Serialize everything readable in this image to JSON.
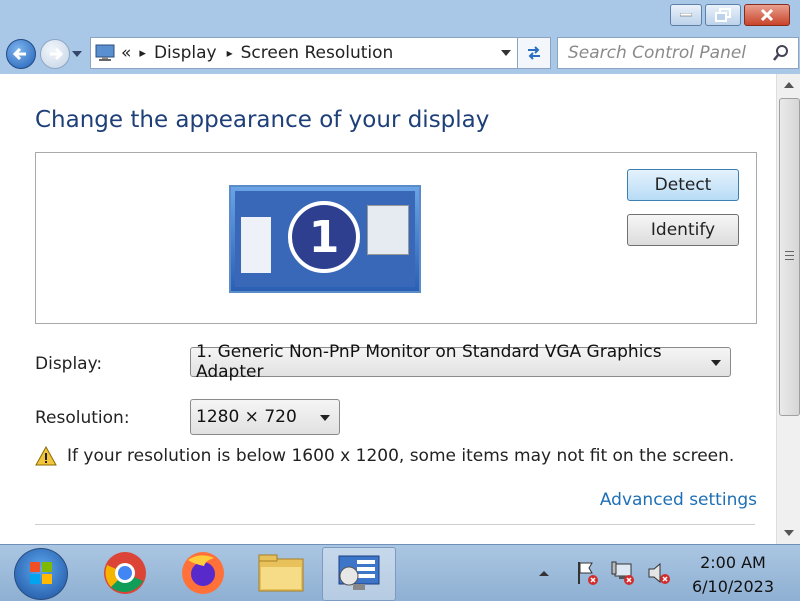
{
  "window": {
    "controls": {
      "minimize_icon": "minimize-icon",
      "maximize_icon": "restore-icon",
      "close_icon": "close-icon"
    }
  },
  "address": {
    "overflow": "«",
    "crumbs": [
      "Display",
      "Screen Resolution"
    ],
    "search_placeholder": "Search Control Panel"
  },
  "main": {
    "title": "Change the appearance of your display",
    "monitor_number": "1",
    "detect_button": "Detect",
    "identify_button": "Identify",
    "display_label": "Display:",
    "display_value": "1. Generic Non-PnP Monitor on Standard VGA Graphics Adapter",
    "resolution_label": "Resolution:",
    "resolution_value": "1280 × 720",
    "warning": "If your resolution is below 1600 x 1200, some items may not fit on the screen.",
    "advanced_link": "Advanced settings"
  },
  "taskbar": {
    "items": [
      "start-button",
      "chrome-icon",
      "firefox-icon",
      "file-explorer-icon",
      "control-panel-icon"
    ],
    "clock_time": "2:00 AM",
    "clock_date": "6/10/2023"
  },
  "colors": {
    "accent": "#1e3f78",
    "link": "#1e6fb5",
    "titlebar": "#a9c7e6"
  }
}
